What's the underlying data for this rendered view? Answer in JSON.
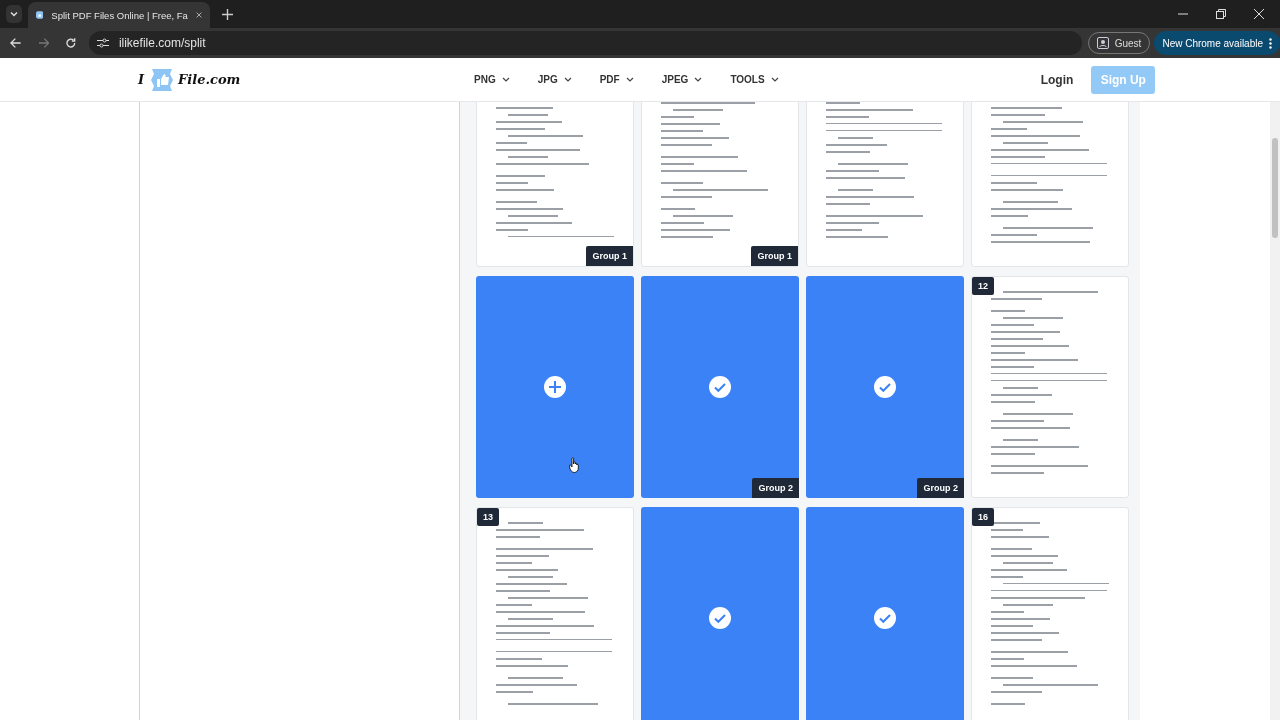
{
  "browser": {
    "tab_title": "Split PDF Files Online | Free, Fa",
    "url": "ilikefile.com/split",
    "profile": "Guest",
    "update_button": "New Chrome available"
  },
  "site": {
    "logo_prefix": "I",
    "logo_suffix": "File.com",
    "nav": [
      "PNG",
      "JPG",
      "PDF",
      "JPEG",
      "TOOLS"
    ],
    "login": "Login",
    "signup": "Sign Up"
  },
  "pages": [
    {
      "kind": "page",
      "group": "Group 1"
    },
    {
      "kind": "page",
      "group": "Group 1"
    },
    {
      "kind": "page"
    },
    {
      "kind": "page"
    },
    {
      "kind": "add"
    },
    {
      "kind": "selected",
      "group": "Group 2"
    },
    {
      "kind": "selected",
      "group": "Group 2"
    },
    {
      "kind": "page",
      "number": "12"
    },
    {
      "kind": "page",
      "number": "13"
    },
    {
      "kind": "selected"
    },
    {
      "kind": "selected"
    },
    {
      "kind": "page",
      "number": "16"
    }
  ]
}
